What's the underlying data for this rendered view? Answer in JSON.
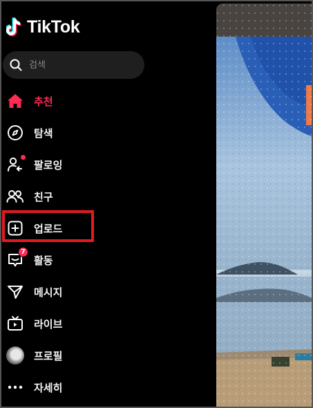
{
  "brand": {
    "name": "TikTok",
    "accent": "#fe2c55",
    "cyan": "#25f4ee"
  },
  "search": {
    "placeholder": "검색"
  },
  "nav": {
    "items": [
      {
        "label": "추천",
        "icon": "home-icon",
        "active": true
      },
      {
        "label": "탐색",
        "icon": "compass-icon"
      },
      {
        "label": "팔로잉",
        "icon": "following-icon",
        "dot": true
      },
      {
        "label": "친구",
        "icon": "friends-icon"
      },
      {
        "label": "업로드",
        "icon": "upload-icon",
        "highlighted": true
      },
      {
        "label": "활동",
        "icon": "activity-icon",
        "badge": "7"
      },
      {
        "label": "메시지",
        "icon": "message-icon"
      },
      {
        "label": "라이브",
        "icon": "live-icon"
      },
      {
        "label": "프로필",
        "icon": "avatar"
      },
      {
        "label": "자세히",
        "icon": "more-icon"
      }
    ]
  },
  "video": {
    "description": "rainy window beach scene"
  }
}
